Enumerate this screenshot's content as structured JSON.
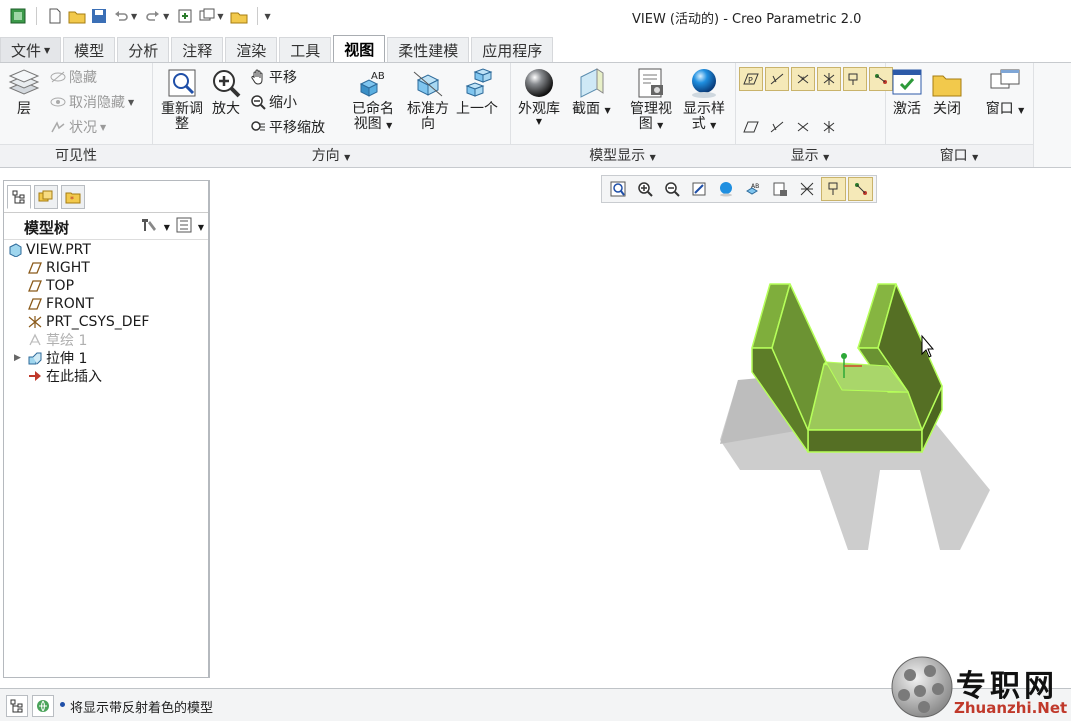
{
  "window": {
    "title": "VIEW (活动的) - Creo Parametric 2.0"
  },
  "tabs": [
    {
      "label": "文件",
      "dropdown": true
    },
    {
      "label": "模型"
    },
    {
      "label": "分析"
    },
    {
      "label": "注释"
    },
    {
      "label": "渲染"
    },
    {
      "label": "工具"
    },
    {
      "label": "视图",
      "active": true
    },
    {
      "label": "柔性建模"
    },
    {
      "label": "应用程序"
    }
  ],
  "ribbon": {
    "visibility": {
      "group_label": "可见性",
      "layers": "层",
      "hide": "隐藏",
      "unhide": "取消隐藏",
      "status": "状况"
    },
    "orientation": {
      "group_label": "方向",
      "refit": "重新调整",
      "zoom_in": "放大",
      "pan": "平移",
      "zoom_out": "缩小",
      "pan_zoom": "平移缩放",
      "named_views": "已命名视图",
      "standard_orientation": "标准方向",
      "previous": "上一个"
    },
    "model_display": {
      "group_label": "模型显示",
      "appearance_gallery": "外观库",
      "section": "截面",
      "manage_views": "管理视图",
      "display_style": "显示样式"
    },
    "show": {
      "group_label": "显示"
    },
    "window": {
      "group_label": "窗口",
      "activate": "激活",
      "close": "关闭",
      "windows": "窗口"
    }
  },
  "model_tree": {
    "title": "模型树",
    "nodes": [
      {
        "label": "VIEW.PRT",
        "icon": "part-icon"
      },
      {
        "label": "RIGHT",
        "icon": "datum-plane-icon"
      },
      {
        "label": "TOP",
        "icon": "datum-plane-icon"
      },
      {
        "label": "FRONT",
        "icon": "datum-plane-icon"
      },
      {
        "label": "PRT_CSYS_DEF",
        "icon": "csys-icon"
      },
      {
        "label": "草绘 1",
        "icon": "sketch-icon",
        "dimmed": true
      },
      {
        "label": "拉伸 1",
        "icon": "extrude-icon",
        "expandable": true
      },
      {
        "label": "在此插入",
        "icon": "insert-arrow-icon"
      }
    ]
  },
  "status_bar": {
    "message": "将显示带反射着色的模型"
  },
  "watermark": {
    "name": "专职网",
    "url": "Zhuanzhi.Net"
  },
  "colors": {
    "model_fill": "#6b9a2c",
    "model_edge": "#b6ff5a",
    "shadow": "#c8c8c8",
    "active_tab_text": "#000000",
    "toggle_on_bg": "#f5e9b8"
  }
}
